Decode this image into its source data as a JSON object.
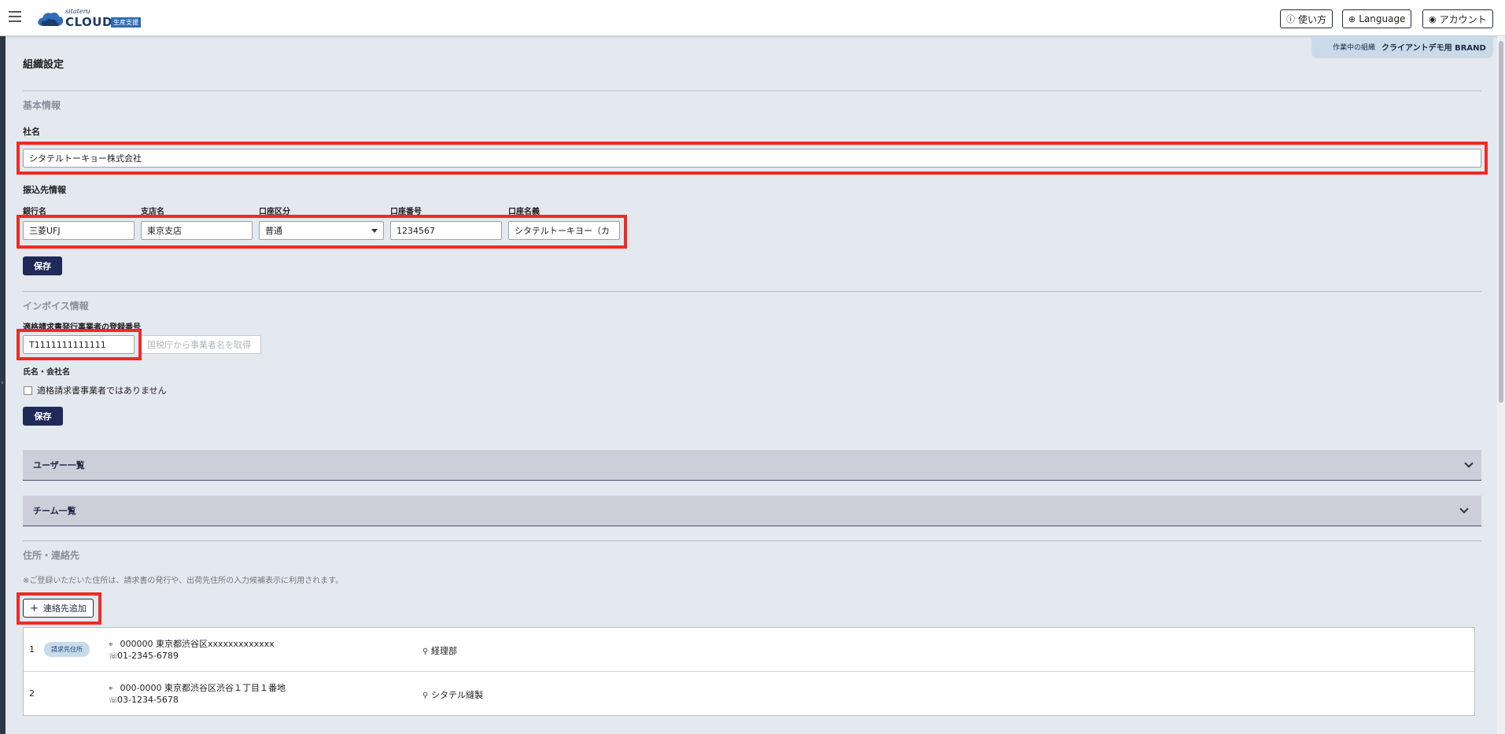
{
  "header": {
    "logo_sub": "sitateru",
    "logo_main": "CLOUD",
    "logo_badge": "生産支援",
    "help_label": "使い方",
    "language_label": "Language",
    "account_label": "アカウント"
  },
  "org_tab": {
    "label": "作業中の組織",
    "value": "クライアントデモ用 BRAND"
  },
  "page": {
    "title": "組織設定"
  },
  "basic": {
    "section_title": "基本情報",
    "company_label": "社名",
    "company_value": "シタテルトーキョー株式会社",
    "bank_section_label": "振込先情報",
    "bank_name_label": "銀行名",
    "bank_name_value": "三菱UFJ",
    "branch_label": "支店名",
    "branch_value": "東京支店",
    "account_type_label": "口座区分",
    "account_type_value": "普通",
    "account_number_label": "口座番号",
    "account_number_value": "1234567",
    "account_holder_label": "口座名義",
    "account_holder_value": "シタテルトーキヨー（カ",
    "save_label": "保存"
  },
  "invoice": {
    "section_title": "インボイス情報",
    "reg_number_label": "適格請求書発行事業者の登録番号",
    "reg_number_value": "T1111111111111",
    "fetch_button_label": "国税庁から事業者名を取得",
    "name_label": "氏名・会社名",
    "not_registered_label": "適格請求書事業者ではありません",
    "save_label": "保存"
  },
  "accordions": {
    "users_label": "ユーザー一覧",
    "teams_label": "チーム一覧"
  },
  "address": {
    "section_title": "住所・連絡先",
    "note": "※ご登録いただいた住所は、請求書の発行や、出荷先住所の入力候補表示に利用されます。",
    "add_button_label": "連絡先追加",
    "rows": [
      {
        "num": "1",
        "tag": "請求先住所",
        "address": "000000 東京都渋谷区xxxxxxxxxxxxx",
        "phone": "01-2345-6789",
        "person": "経理部"
      },
      {
        "num": "2",
        "tag": "",
        "address": "000-0000 東京都渋谷区渋谷１丁目１番地",
        "phone": "03-1234-5678",
        "person": "シタテル縫製"
      }
    ]
  }
}
